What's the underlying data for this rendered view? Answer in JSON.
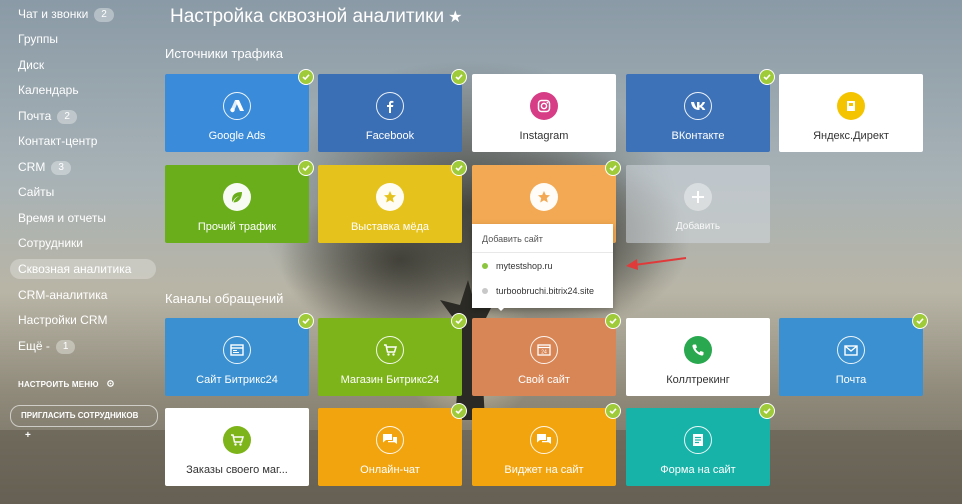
{
  "sidebar": {
    "items": [
      {
        "label": "Чат и звонки",
        "badge": "2"
      },
      {
        "label": "Группы"
      },
      {
        "label": "Диск"
      },
      {
        "label": "Календарь"
      },
      {
        "label": "Почта",
        "badge": "2"
      },
      {
        "label": "Контакт-центр"
      },
      {
        "label": "CRM",
        "badge": "3"
      },
      {
        "label": "Сайты"
      },
      {
        "label": "Время и отчеты"
      },
      {
        "label": "Сотрудники"
      },
      {
        "label": "Сквозная аналитика",
        "active": true
      },
      {
        "label": "CRM-аналитика"
      },
      {
        "label": "Настройки CRM"
      },
      {
        "label": "Ещё -",
        "badge": "1"
      }
    ],
    "configure_menu": "НАСТРОИТЬ МЕНЮ",
    "invite": "ПРИГЛАСИТЬ СОТРУДНИКОВ"
  },
  "page": {
    "title": "Настройка сквозной аналитики",
    "star": "★"
  },
  "sections": {
    "traffic": "Источники трафика",
    "channels": "Каналы обращений"
  },
  "traffic_tiles": [
    {
      "label": "Google Ads",
      "color": "#3a8bd9",
      "icon": "google-ads-icon",
      "checked": true
    },
    {
      "label": "Facebook",
      "color": "#3a6eb5",
      "icon": "facebook-icon",
      "checked": true
    },
    {
      "label": "Instagram",
      "color": "#ffffff",
      "icon": "instagram-icon",
      "checked": false
    },
    {
      "label": "ВКонтакте",
      "color": "#3d72b8",
      "icon": "vk-icon",
      "checked": true
    },
    {
      "label": "Яндекс.Директ",
      "color": "#ffffff",
      "icon": "yandex-direct-icon",
      "checked": false
    },
    {
      "label": "Прочий трафик",
      "color": "#6aae1c",
      "icon": "leaf-icon",
      "checked": true
    },
    {
      "label": "Выставка мёда",
      "color": "#e6c21c",
      "icon": "star-icon",
      "checked": true
    },
    {
      "label": "",
      "color": "#f3a953",
      "icon": "star-icon",
      "checked": true
    },
    {
      "label": "Добавить",
      "color": "add",
      "icon": "plus-icon",
      "checked": false
    }
  ],
  "popup": {
    "header": "Добавить сайт",
    "items": [
      {
        "label": "mytestshop.ru",
        "dot": "#8cc63f"
      },
      {
        "label": "turboobruchi.bitrix24.site",
        "dot": "#c8c8c8"
      }
    ]
  },
  "channel_tiles": [
    {
      "label": "Сайт Битрикс24",
      "color": "#3a90d0",
      "icon": "browser-icon",
      "checked": true
    },
    {
      "label": "Магазин Битрикс24",
      "color": "#7cb419",
      "icon": "cart-icon",
      "checked": true
    },
    {
      "label": "Свой сайт",
      "color": "#d98656",
      "icon": "site24-icon",
      "checked": true
    },
    {
      "label": "Коллтрекинг",
      "color": "#ffffff",
      "icon": "call-tracking-icon",
      "checked": false
    },
    {
      "label": "Почта",
      "color": "#3a90d0",
      "icon": "mail-icon",
      "checked": true
    },
    {
      "label": "Заказы своего маг...",
      "color": "#ffffff",
      "icon": "cart-icon",
      "checked": false
    },
    {
      "label": "Онлайн-чат",
      "color": "#f2a40f",
      "icon": "chat-icon",
      "checked": true
    },
    {
      "label": "Виджет на сайт",
      "color": "#f2a40f",
      "icon": "chat-icon",
      "checked": true
    },
    {
      "label": "Форма на сайт",
      "color": "#17b3a8",
      "icon": "form-icon",
      "checked": true
    }
  ]
}
